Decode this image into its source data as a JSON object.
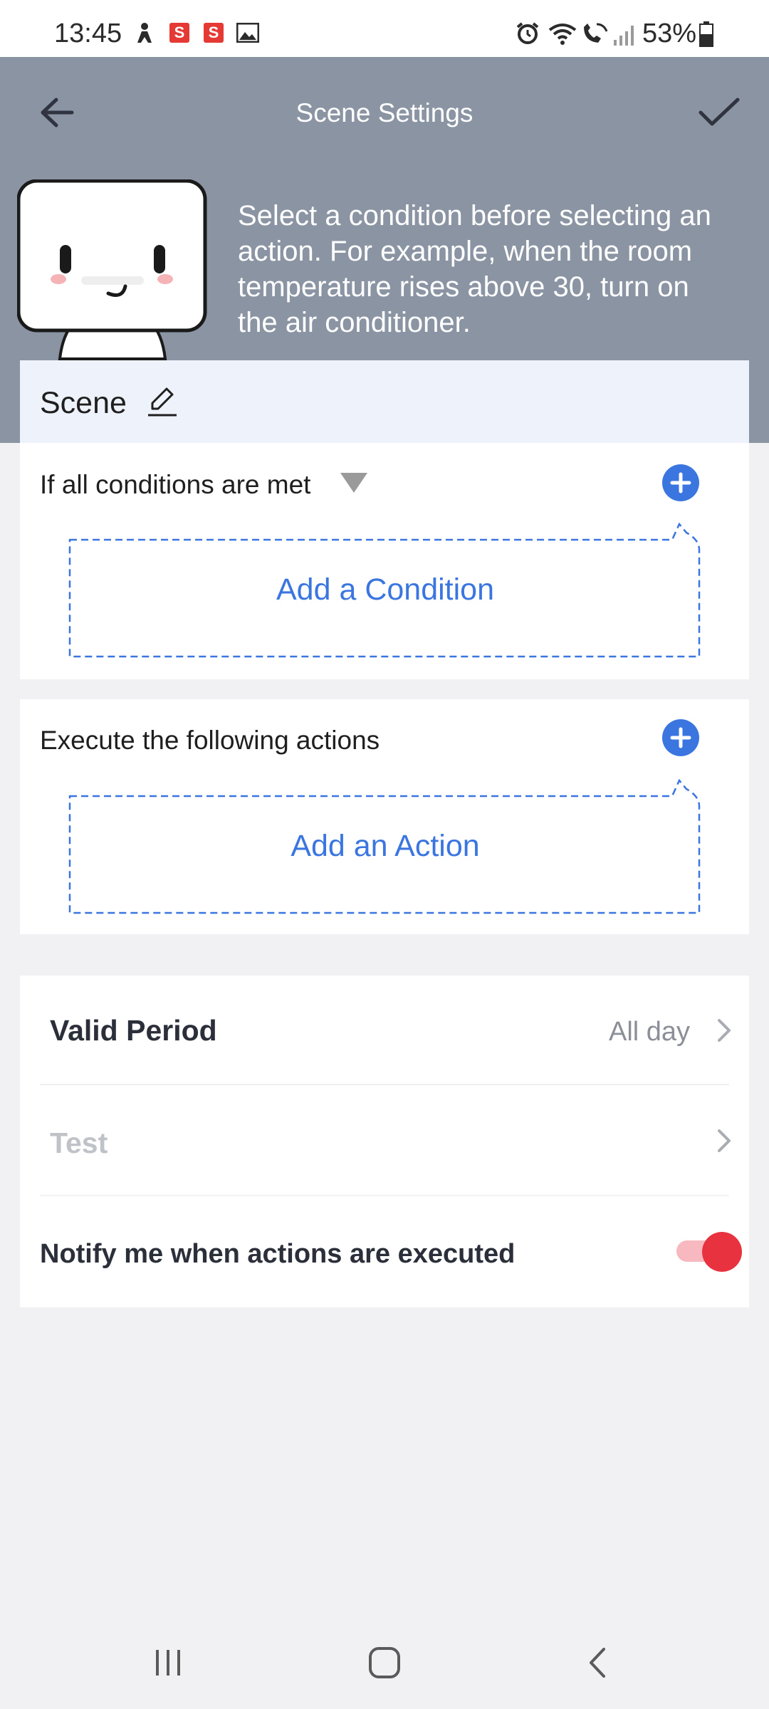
{
  "status_bar": {
    "time": "13:45",
    "badge_1": "S",
    "badge_2": "S",
    "battery_percent": "53%",
    "icons": [
      "person-icon",
      "s-app-icon",
      "s-app-icon",
      "image-icon",
      "alarm-icon",
      "wifi-icon",
      "wifi-calling-icon",
      "signal-icon",
      "battery-icon"
    ]
  },
  "header": {
    "title": "Scene Settings",
    "hint": "Select a condition before selecting an action. For example, when the room temperature rises above 30, turn on the air conditioner.",
    "back_icon": "arrow-left-icon",
    "confirm_icon": "checkmark-icon"
  },
  "scene": {
    "name": "Scene",
    "edit_icon": "pencil-icon"
  },
  "conditions": {
    "title": "If all conditions are met",
    "add_label": "Add a Condition"
  },
  "actions": {
    "title": "Execute the following actions",
    "add_label": "Add an Action"
  },
  "settings": {
    "valid_period_label": "Valid Period",
    "valid_period_value": "All day",
    "test_label": "Test",
    "notify_label": "Notify me when actions are executed",
    "notify_enabled": true
  },
  "colors": {
    "header_bg": "#8a94a2",
    "accent_blue": "#3b76e0",
    "toggle_on": "#e8323f",
    "page_bg": "#f1f1f3"
  },
  "nav": {
    "icons": [
      "recent-apps-icon",
      "home-icon",
      "back-icon"
    ]
  }
}
